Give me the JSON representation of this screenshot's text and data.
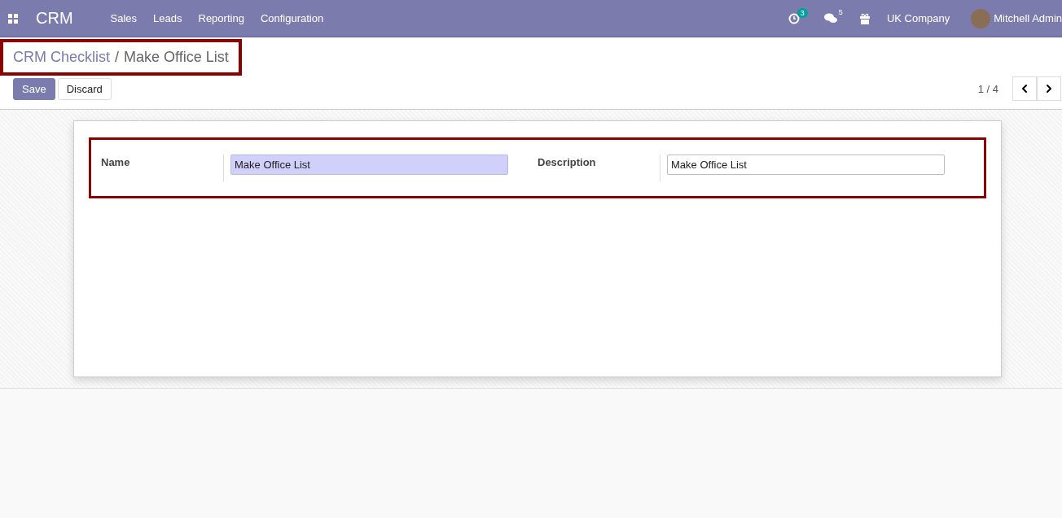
{
  "navbar": {
    "app_name": "CRM",
    "menu": [
      "Sales",
      "Leads",
      "Reporting",
      "Configuration"
    ],
    "activity_count": "3",
    "message_count": "5",
    "company": "UK Company",
    "user": "Mitchell Admin"
  },
  "breadcrumb": {
    "parent": "CRM Checklist",
    "separator": "/",
    "current": "Make Office List"
  },
  "buttons": {
    "save": "Save",
    "discard": "Discard"
  },
  "pager": {
    "value": "1 / 4"
  },
  "fields": [
    {
      "label": "Name",
      "value": "Make Office List",
      "focused": true
    },
    {
      "label": "Description",
      "value": "Make Office List",
      "focused": false
    }
  ]
}
